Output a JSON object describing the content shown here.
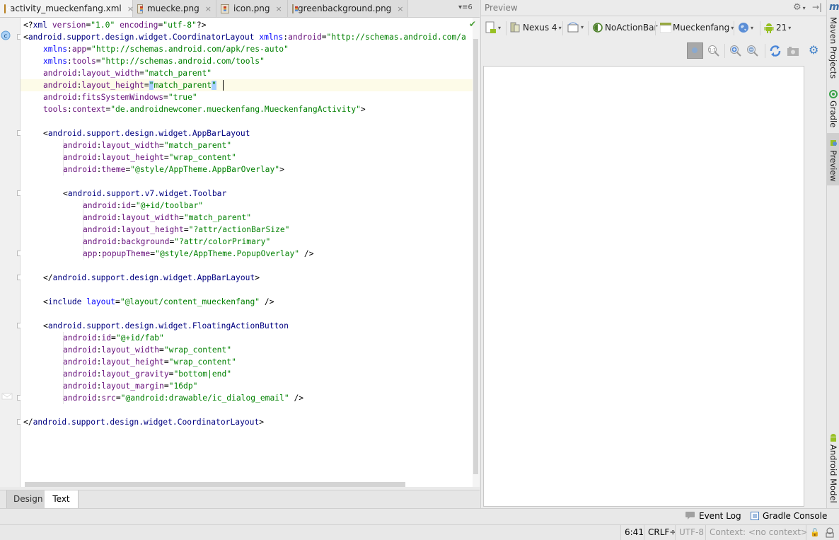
{
  "editor_tabs": [
    {
      "label": "activity_mueckenfang.xml",
      "icon": "xml-file-icon",
      "active": true
    },
    {
      "label": "muecke.png",
      "icon": "image-file-icon",
      "active": false
    },
    {
      "label": "icon.png",
      "icon": "image-file-icon",
      "active": false
    },
    {
      "label": "greenbackground.png",
      "icon": "image-file-icon",
      "active": false
    }
  ],
  "tab_overflow_label": "▾≡6",
  "close_glyph": "×",
  "code_lines": [
    {
      "indent": 0,
      "tokens": [
        [
          "punct",
          "<?"
        ],
        [
          "tag",
          "xml "
        ],
        [
          "attr",
          "version"
        ],
        [
          "punct",
          "="
        ],
        [
          "val",
          "\"1.0\" "
        ],
        [
          "attr",
          "encoding"
        ],
        [
          "punct",
          "="
        ],
        [
          "val",
          "\"utf-8\""
        ],
        [
          "punct",
          "?>"
        ]
      ]
    },
    {
      "indent": 0,
      "tokens": [
        [
          "punct",
          "<"
        ],
        [
          "tag",
          "android.support.design.widget.CoordinatorLayout "
        ],
        [
          "ns",
          "xmlns"
        ],
        [
          "punct",
          ":"
        ],
        [
          "attr",
          "android"
        ],
        [
          "punct",
          "="
        ],
        [
          "val",
          "\"http://schemas.android.com/a"
        ]
      ]
    },
    {
      "indent": 1,
      "tokens": [
        [
          "ns",
          "xmlns"
        ],
        [
          "punct",
          ":"
        ],
        [
          "attr",
          "app"
        ],
        [
          "punct",
          "="
        ],
        [
          "val",
          "\"http://schemas.android.com/apk/res-auto\""
        ]
      ]
    },
    {
      "indent": 1,
      "tokens": [
        [
          "ns",
          "xmlns"
        ],
        [
          "punct",
          ":"
        ],
        [
          "attr",
          "tools"
        ],
        [
          "punct",
          "="
        ],
        [
          "val",
          "\"http://schemas.android.com/tools\""
        ]
      ]
    },
    {
      "indent": 1,
      "tokens": [
        [
          "attr",
          "android"
        ],
        [
          "punct",
          ":"
        ],
        [
          "attr",
          "layout_width"
        ],
        [
          "punct",
          "="
        ],
        [
          "val",
          "\"match_parent\""
        ]
      ]
    },
    {
      "indent": 1,
      "tokens": [
        [
          "attr",
          "android"
        ],
        [
          "punct",
          ":"
        ],
        [
          "attr",
          "layout_height"
        ],
        [
          "punct",
          "="
        ],
        [
          "sel",
          "\""
        ],
        [
          "val",
          "match_parent"
        ],
        [
          "sel",
          "\""
        ]
      ]
    },
    {
      "indent": 1,
      "tokens": [
        [
          "attr",
          "android"
        ],
        [
          "punct",
          ":"
        ],
        [
          "attr",
          "fitsSystemWindows"
        ],
        [
          "punct",
          "="
        ],
        [
          "val",
          "\"true\""
        ]
      ]
    },
    {
      "indent": 1,
      "tokens": [
        [
          "attr",
          "tools"
        ],
        [
          "punct",
          ":"
        ],
        [
          "attr",
          "context"
        ],
        [
          "punct",
          "="
        ],
        [
          "val",
          "\"de.androidnewcomer.mueckenfang.MueckenfangActivity\""
        ],
        [
          "punct",
          ">"
        ]
      ]
    },
    {
      "indent": 0,
      "tokens": []
    },
    {
      "indent": 1,
      "tokens": [
        [
          "punct",
          "<"
        ],
        [
          "tag",
          "android.support.design.widget.AppBarLayout"
        ]
      ]
    },
    {
      "indent": 2,
      "tokens": [
        [
          "attr",
          "android"
        ],
        [
          "punct",
          ":"
        ],
        [
          "attr",
          "layout_width"
        ],
        [
          "punct",
          "="
        ],
        [
          "val",
          "\"match_parent\""
        ]
      ]
    },
    {
      "indent": 2,
      "tokens": [
        [
          "attr",
          "android"
        ],
        [
          "punct",
          ":"
        ],
        [
          "attr",
          "layout_height"
        ],
        [
          "punct",
          "="
        ],
        [
          "val",
          "\"wrap_content\""
        ]
      ]
    },
    {
      "indent": 2,
      "tokens": [
        [
          "attr",
          "android"
        ],
        [
          "punct",
          ":"
        ],
        [
          "attr",
          "theme"
        ],
        [
          "punct",
          "="
        ],
        [
          "val",
          "\"@style/AppTheme.AppBarOverlay\""
        ],
        [
          "punct",
          ">"
        ]
      ]
    },
    {
      "indent": 0,
      "tokens": []
    },
    {
      "indent": 2,
      "tokens": [
        [
          "punct",
          "<"
        ],
        [
          "tag",
          "android.support.v7.widget.Toolbar"
        ]
      ]
    },
    {
      "indent": 3,
      "tokens": [
        [
          "attr",
          "android"
        ],
        [
          "punct",
          ":"
        ],
        [
          "attr",
          "id"
        ],
        [
          "punct",
          "="
        ],
        [
          "val",
          "\"@+id/toolbar\""
        ]
      ]
    },
    {
      "indent": 3,
      "tokens": [
        [
          "attr",
          "android"
        ],
        [
          "punct",
          ":"
        ],
        [
          "attr",
          "layout_width"
        ],
        [
          "punct",
          "="
        ],
        [
          "val",
          "\"match_parent\""
        ]
      ]
    },
    {
      "indent": 3,
      "tokens": [
        [
          "attr",
          "android"
        ],
        [
          "punct",
          ":"
        ],
        [
          "attr",
          "layout_height"
        ],
        [
          "punct",
          "="
        ],
        [
          "val",
          "\"?attr/actionBarSize\""
        ]
      ]
    },
    {
      "indent": 3,
      "tokens": [
        [
          "attr",
          "android"
        ],
        [
          "punct",
          ":"
        ],
        [
          "attr",
          "background"
        ],
        [
          "punct",
          "="
        ],
        [
          "val",
          "\"?attr/colorPrimary\""
        ]
      ]
    },
    {
      "indent": 3,
      "tokens": [
        [
          "attr",
          "app"
        ],
        [
          "punct",
          ":"
        ],
        [
          "attr",
          "popupTheme"
        ],
        [
          "punct",
          "="
        ],
        [
          "val",
          "\"@style/AppTheme.PopupOverlay\""
        ],
        [
          "punct",
          " />"
        ]
      ]
    },
    {
      "indent": 0,
      "tokens": []
    },
    {
      "indent": 1,
      "tokens": [
        [
          "punct",
          "</"
        ],
        [
          "tag",
          "android.support.design.widget.AppBarLayout"
        ],
        [
          "punct",
          ">"
        ]
      ]
    },
    {
      "indent": 0,
      "tokens": []
    },
    {
      "indent": 1,
      "tokens": [
        [
          "punct",
          "<"
        ],
        [
          "tag",
          "include "
        ],
        [
          "ns",
          "layout"
        ],
        [
          "punct",
          "="
        ],
        [
          "val",
          "\"@layout/content_mueckenfang\""
        ],
        [
          "punct",
          " />"
        ]
      ]
    },
    {
      "indent": 0,
      "tokens": []
    },
    {
      "indent": 1,
      "tokens": [
        [
          "punct",
          "<"
        ],
        [
          "tag",
          "android.support.design.widget.FloatingActionButton"
        ]
      ]
    },
    {
      "indent": 2,
      "tokens": [
        [
          "attr",
          "android"
        ],
        [
          "punct",
          ":"
        ],
        [
          "attr",
          "id"
        ],
        [
          "punct",
          "="
        ],
        [
          "val",
          "\"@+id/fab\""
        ]
      ]
    },
    {
      "indent": 2,
      "tokens": [
        [
          "attr",
          "android"
        ],
        [
          "punct",
          ":"
        ],
        [
          "attr",
          "layout_width"
        ],
        [
          "punct",
          "="
        ],
        [
          "val",
          "\"wrap_content\""
        ]
      ]
    },
    {
      "indent": 2,
      "tokens": [
        [
          "attr",
          "android"
        ],
        [
          "punct",
          ":"
        ],
        [
          "attr",
          "layout_height"
        ],
        [
          "punct",
          "="
        ],
        [
          "val",
          "\"wrap_content\""
        ]
      ]
    },
    {
      "indent": 2,
      "tokens": [
        [
          "attr",
          "android"
        ],
        [
          "punct",
          ":"
        ],
        [
          "attr",
          "layout_gravity"
        ],
        [
          "punct",
          "="
        ],
        [
          "val",
          "\"bottom|end\""
        ]
      ]
    },
    {
      "indent": 2,
      "tokens": [
        [
          "attr",
          "android"
        ],
        [
          "punct",
          ":"
        ],
        [
          "attr",
          "layout_margin"
        ],
        [
          "punct",
          "="
        ],
        [
          "val",
          "\"16dp\""
        ]
      ]
    },
    {
      "indent": 2,
      "tokens": [
        [
          "attr",
          "android"
        ],
        [
          "punct",
          ":"
        ],
        [
          "attr",
          "src"
        ],
        [
          "punct",
          "="
        ],
        [
          "val",
          "\"@android:drawable/ic_dialog_email\""
        ],
        [
          "punct",
          " />"
        ]
      ]
    },
    {
      "indent": 0,
      "tokens": []
    },
    {
      "indent": 0,
      "tokens": [
        [
          "punct",
          "</"
        ],
        [
          "tag",
          "android.support.design.widget.CoordinatorLayout"
        ],
        [
          "punct",
          ">"
        ]
      ]
    }
  ],
  "editor_mode_tabs": {
    "design": "Design",
    "text": "Text",
    "active": "Text"
  },
  "preview": {
    "title": "Preview",
    "device": "Nexus 4",
    "theme": "NoActionBar",
    "activity": "Mueckenfang",
    "api_level": "21",
    "toolbar_icons": [
      "virtual-device-icon",
      "device-icon",
      "orientation-icon",
      "theme-icon",
      "activity-icon",
      "locale-globe-icon",
      "android-api-icon"
    ],
    "zoom_icons": [
      "zoom-to-fit-icon",
      "actual-size-icon",
      "zoom-in-icon",
      "zoom-out-icon",
      "refresh-icon",
      "screenshot-icon",
      "preview-settings-icon"
    ]
  },
  "right_stripe": {
    "maven": "Maven Projects",
    "gradle": "Gradle",
    "preview": "Preview",
    "android_model": "Android Model"
  },
  "tool_windows": {
    "event_log": "Event Log",
    "gradle_console": "Gradle Console"
  },
  "status_bar": {
    "position": "6:41",
    "line_separator": "CRLF÷",
    "encoding": "UTF-8",
    "context": "Context: <no context>"
  }
}
